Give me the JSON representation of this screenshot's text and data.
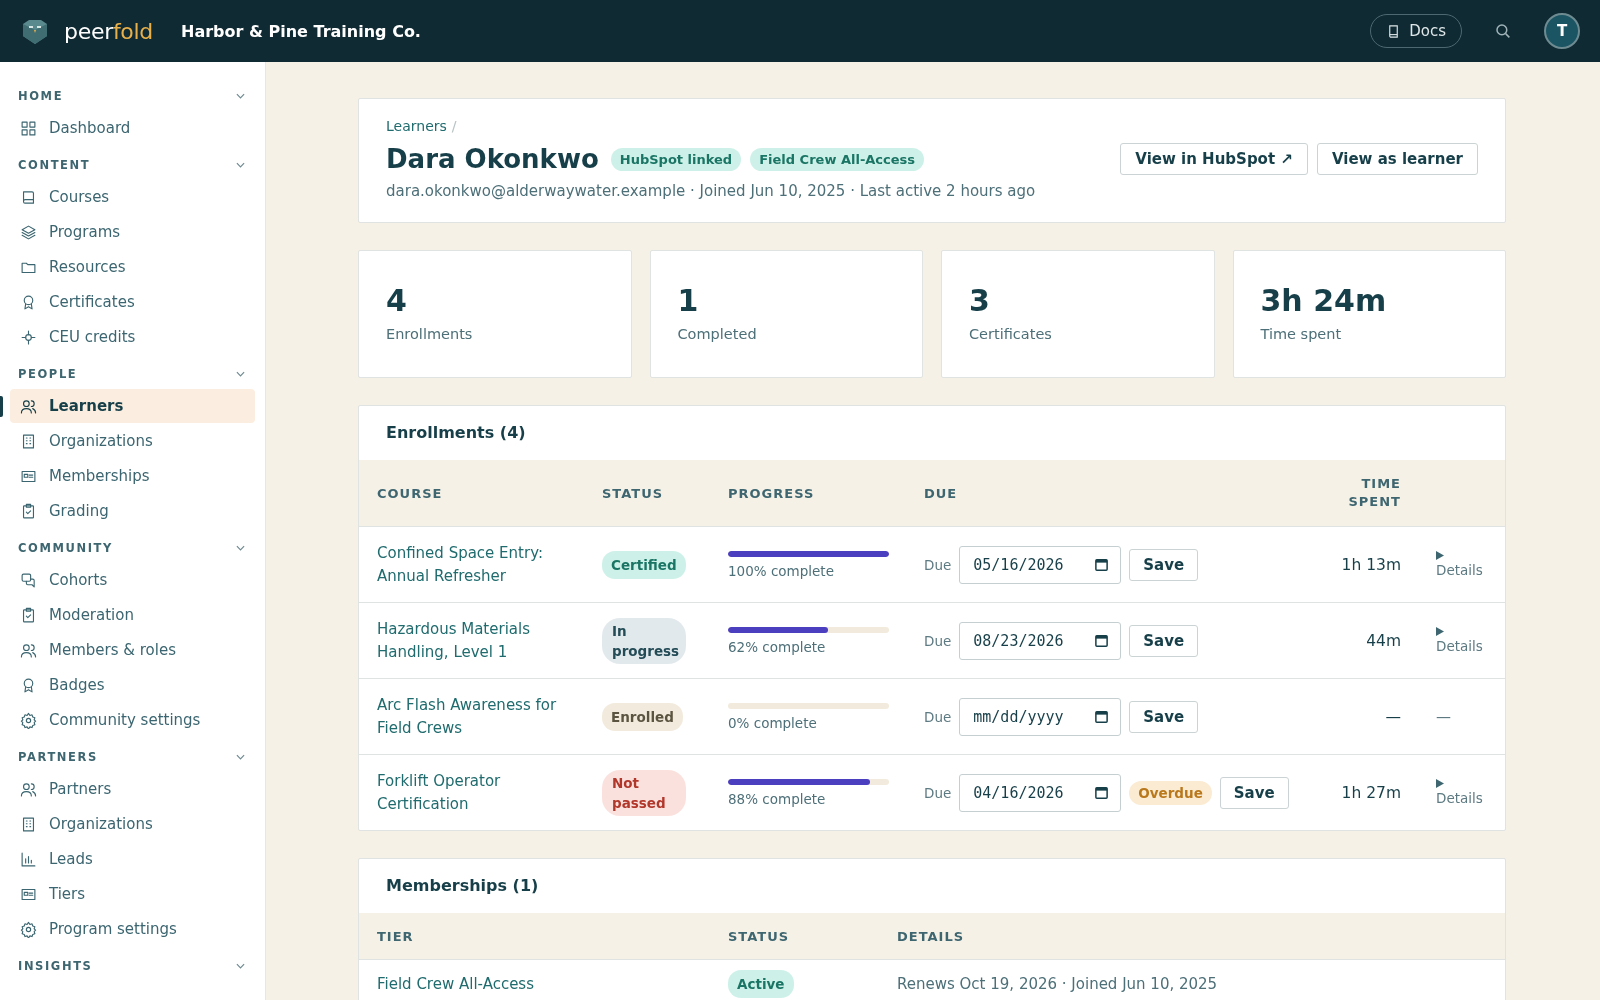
{
  "topbar": {
    "brand_a": "peer",
    "brand_b": "fold",
    "org": "Harbor & Pine Training Co.",
    "docs": "Docs",
    "avatar": "T"
  },
  "sidebar": [
    {
      "label": "HOME",
      "items": [
        {
          "label": "Dashboard",
          "selected": false
        }
      ]
    },
    {
      "label": "CONTENT",
      "items": [
        {
          "label": "Courses",
          "selected": false
        },
        {
          "label": "Programs",
          "selected": false
        },
        {
          "label": "Resources",
          "selected": false
        },
        {
          "label": "Certificates",
          "selected": false
        },
        {
          "label": "CEU credits",
          "selected": false
        }
      ]
    },
    {
      "label": "PEOPLE",
      "items": [
        {
          "label": "Learners",
          "selected": true
        },
        {
          "label": "Organizations",
          "selected": false
        },
        {
          "label": "Memberships",
          "selected": false
        },
        {
          "label": "Grading",
          "selected": false
        }
      ]
    },
    {
      "label": "COMMUNITY",
      "items": [
        {
          "label": "Cohorts",
          "selected": false
        },
        {
          "label": "Moderation",
          "selected": false
        },
        {
          "label": "Members & roles",
          "selected": false
        },
        {
          "label": "Badges",
          "selected": false
        },
        {
          "label": "Community settings",
          "selected": false
        }
      ]
    },
    {
      "label": "PARTNERS",
      "items": [
        {
          "label": "Partners",
          "selected": false
        },
        {
          "label": "Organizations",
          "selected": false
        },
        {
          "label": "Leads",
          "selected": false
        },
        {
          "label": "Tiers",
          "selected": false
        },
        {
          "label": "Program settings",
          "selected": false
        }
      ]
    },
    {
      "label": "INSIGHTS"
    }
  ],
  "profile": {
    "breadcrumb": "Learners",
    "separator": "/",
    "name": "Dara Okonkwo",
    "tags": [
      "HubSpot linked",
      "Field Crew All-Access"
    ],
    "meta": "dara.okonkwo@alderwaywater.example · Joined Jun 10, 2025 · Last active 2 hours ago",
    "buttons": [
      "View in HubSpot ↗",
      "View as learner"
    ]
  },
  "stats": [
    {
      "value": "4",
      "label": "Enrollments"
    },
    {
      "value": "1",
      "label": "Completed"
    },
    {
      "value": "3",
      "label": "Certificates"
    },
    {
      "value": "3h 24m",
      "label": "Time spent"
    }
  ],
  "enrollments": {
    "title": "Enrollments (4)",
    "columns": [
      "COURSE",
      "STATUS",
      "PROGRESS",
      "DUE",
      "TIME SPENT"
    ],
    "rows": [
      {
        "course": "Confined Space Entry: Annual Refresher",
        "status": "Certified",
        "kind": "certified",
        "level": 1.0,
        "progress": "100% complete",
        "due_label": "Due",
        "date": "05/16/2026",
        "overdue": null,
        "save": "Save",
        "time": "1h 13m",
        "details": "Details"
      },
      {
        "course": "Hazardous Materials Handling, Level 1",
        "status": "In progress",
        "kind": "in_progress",
        "level": 0.62,
        "progress": "62% complete",
        "due_label": "Due",
        "date": "08/23/2026",
        "overdue": null,
        "save": "Save",
        "time": "44m",
        "details": "Details"
      },
      {
        "course": "Arc Flash Awareness for Field Crews",
        "status": "Enrolled",
        "kind": "enrolled",
        "level": 0.0,
        "progress": "0% complete",
        "due_label": "Due",
        "placeholder": "mm/dd/yyyy",
        "overdue": null,
        "save": "Save",
        "time": "—",
        "details_dash": "—"
      },
      {
        "course": "Forklift Operator Certification",
        "status": "Not passed",
        "kind": "not_passed",
        "level": 0.88,
        "progress": "88% complete",
        "due_label": "Due",
        "date": "04/16/2026",
        "overdue": "Overdue",
        "save": "Save",
        "time": "1h 27m",
        "details": "Details"
      }
    ]
  },
  "memberships": {
    "title": "Memberships (1)",
    "columns": [
      "TIER",
      "STATUS",
      "DETAILS"
    ],
    "rows": [
      {
        "tier": "Field Crew All-Access",
        "status": "Active",
        "kind": "active",
        "details": "Renews Oct 19, 2026 · Joined Jun 10, 2025"
      }
    ]
  }
}
